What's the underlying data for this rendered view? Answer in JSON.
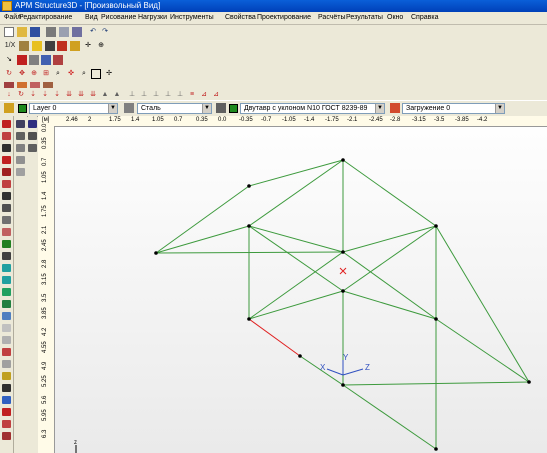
{
  "window": {
    "title": "APM Structure3D - [Произвольный Вид]"
  },
  "menu": [
    "Файл",
    "Редактирование",
    "Вид",
    "Рисование",
    "Нагрузки",
    "Инструменты",
    "Свойства",
    "Проектирование",
    "Расчёты",
    "Результаты",
    "Окно",
    "Справка"
  ],
  "toolbar": {
    "scale_label": "1/X"
  },
  "properties": {
    "layer": "Layer 0",
    "material": "Сталь",
    "section": "Двутавр с уклоном N10 ГОСТ 8239-89",
    "loading": "Загружение 0",
    "colors": {
      "layer": "#1e8a1e",
      "section": "#1e8a1e",
      "accent": "#d24a2e"
    }
  },
  "rulers": {
    "unit": "[м]",
    "top": [
      "2.46",
      "2",
      "1.75",
      "1.4",
      "1.05",
      "0.7",
      "0.35",
      "0.0",
      "-0.35",
      "-0.7",
      "-1.05",
      "-1.4",
      "-1.75",
      "-2.1",
      "-2.45",
      "-2.8",
      "-3.15",
      "-3.5",
      "-3.85",
      "-4.2"
    ],
    "left": [
      "0.0",
      "0.35",
      "0.7",
      "1.05",
      "1.4",
      "1.75",
      "2.1",
      "2.45",
      "2.8",
      "3.15",
      "3.5",
      "3.85",
      "4.2",
      "4.55",
      "4.9",
      "5.25",
      "5.6",
      "5.95",
      "6.3"
    ]
  },
  "axes": {
    "x": "X",
    "y": "Y",
    "z": "Z"
  },
  "model": {
    "member_color": "#3d9a3d",
    "node_color": "#000000",
    "selected_color": "#e02020",
    "center_color": "#e02020"
  }
}
